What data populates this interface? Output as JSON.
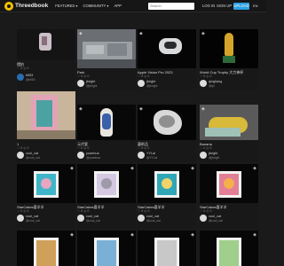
{
  "header": {
    "logo_text": "Threedbook",
    "nav": [
      "FEATURES ▾",
      "COMMUNITY ▾",
      "APP"
    ],
    "search_placeholder": "Search",
    "login": "LOG IN",
    "signup": "SIGN UP",
    "upload": "UPLOAD",
    "lang": "EN"
  },
  "cards": [
    {
      "title": "摆拍",
      "stats": "♡ 0  ◎ 0",
      "user": "bfi53",
      "handle": "@bfi53",
      "badge": "◈",
      "avatar_color": "#eeeeee"
    },
    {
      "title": "Park",
      "stats": "♡ 0  ◎ 0",
      "user": "jbright",
      "handle": "@jbright",
      "badge": "◈",
      "avatar_color": "#e6e6e6"
    },
    {
      "title": "Apple Vision Pro 2023",
      "stats": "♡ 0  ◎ 0",
      "user": "jbright",
      "handle": "@jbright",
      "badge": "◈",
      "avatar_color": "#e6e6e6"
    },
    {
      "title": "World Cup Trophy 大力神杯",
      "stats": "♡ 0  ◎ 0",
      "user": "qingliang",
      "handle": "@qli",
      "badge": "◈",
      "avatar_color": "#eeeeee"
    },
    {
      "title": "1",
      "stats": "♡ 0  ◎ 0",
      "user": "cool_cat",
      "handle": "@cool_cat",
      "badge": "◈",
      "avatar_color": "#ffffff"
    },
    {
      "title": "元代瓷",
      "stats": "♡ 0  ◎ 0",
      "user": "yuanhua",
      "handle": "@yuanhua",
      "badge": "◈",
      "avatar_color": "#f0f0f0"
    },
    {
      "title": "藝術品",
      "stats": "♡ 0  ◎ 0",
      "user": "YYLai",
      "handle": "@YYLai",
      "badge": "◈",
      "avatar_color": "#f0f0f0"
    },
    {
      "title": "Banana",
      "stats": "♡ 0  ◎ 0",
      "user": "jbright",
      "handle": "@jbright",
      "badge": "◈",
      "avatar_color": "#e6e6e6"
    },
    {
      "title": "StarCakes喜羊羊",
      "stats": "♡ 0  ◎ 0",
      "user": "cool_cat",
      "handle": "@cool_cat",
      "badge": "◈",
      "avatar_color": "#ffffff"
    },
    {
      "title": "StarCakes喜羊羊",
      "stats": "♡ 0  ◎ 0",
      "user": "cool_cat",
      "handle": "@cool_cat",
      "badge": "◈",
      "avatar_color": "#ffffff"
    },
    {
      "title": "StarCakes喜羊羊",
      "stats": "♡ 0  ◎ 0",
      "user": "cool_cat",
      "handle": "@cool_cat",
      "badge": "◈",
      "avatar_color": "#ffffff"
    },
    {
      "title": "StarCakes喜羊羊",
      "stats": "♡ 0  ◎ 0",
      "user": "cool_cat",
      "handle": "@cool_cat",
      "badge": "◈",
      "avatar_color": "#ffffff"
    },
    {
      "title": "",
      "stats": "",
      "user": "",
      "handle": "",
      "badge": "◈",
      "avatar_color": "#ffffff"
    },
    {
      "title": "",
      "stats": "",
      "user": "",
      "handle": "",
      "badge": "◈",
      "avatar_color": "#ffffff"
    },
    {
      "title": "",
      "stats": "",
      "user": "",
      "handle": "",
      "badge": "◈",
      "avatar_color": "#ffffff"
    },
    {
      "title": "",
      "stats": "",
      "user": "",
      "handle": "",
      "badge": "◈",
      "avatar_color": "#ffffff"
    }
  ],
  "colors": {
    "accent": "#2ba0e0",
    "logo": "#f2c200",
    "bg": "#1a1a1a"
  }
}
